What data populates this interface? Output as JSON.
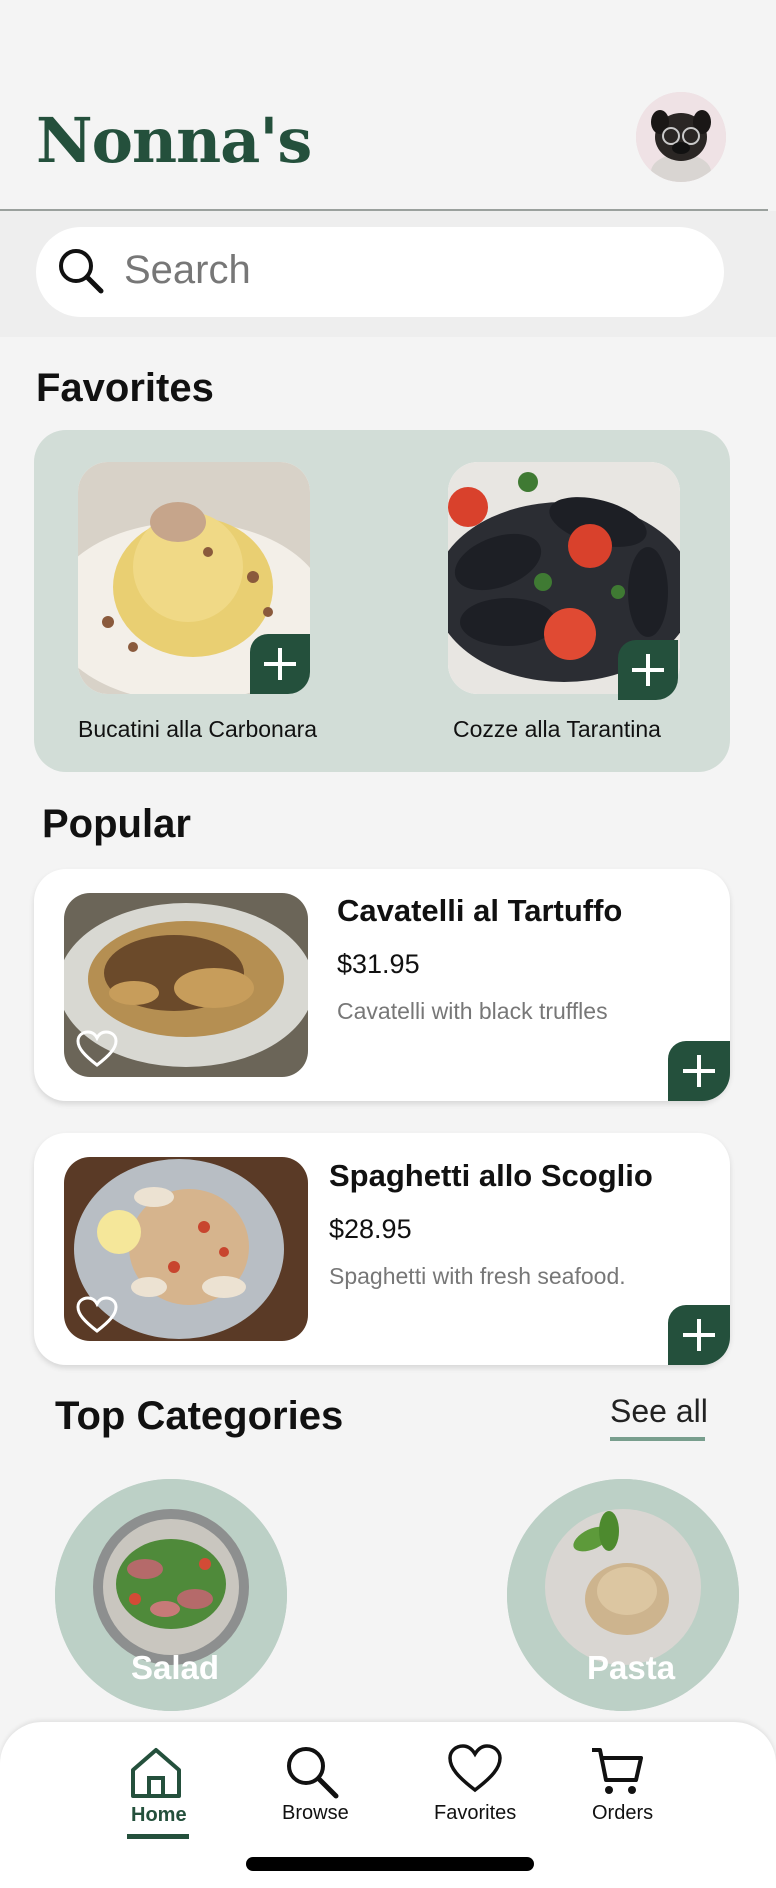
{
  "app": {
    "logo_text": "Nonna's",
    "brand_color": "#24503c",
    "accent_soft": "#d2ddd7"
  },
  "search": {
    "placeholder": "Search",
    "icon": "search-icon"
  },
  "favorites": {
    "title": "Favorites",
    "items": [
      {
        "name": "Bucatini alla Carbonara"
      },
      {
        "name": "Cozze alla Tarantina"
      }
    ]
  },
  "popular": {
    "title": "Popular",
    "items": [
      {
        "name": "Cavatelli al Tartuffo",
        "price": "$31.95",
        "description": "Cavatelli with black truffles"
      },
      {
        "name": "Spaghetti allo Scoglio",
        "price": "$28.95",
        "description": "Spaghetti with fresh seafood."
      }
    ]
  },
  "categories": {
    "title": "Top Categories",
    "see_all": "See all",
    "items": [
      {
        "name": "Salad"
      },
      {
        "name": "Pasta"
      }
    ]
  },
  "nav": {
    "items": [
      {
        "label": "Home",
        "icon": "home-icon",
        "active": true
      },
      {
        "label": "Browse",
        "icon": "search-icon",
        "active": false
      },
      {
        "label": "Favorites",
        "icon": "heart-icon",
        "active": false
      },
      {
        "label": "Orders",
        "icon": "cart-icon",
        "active": false
      }
    ]
  }
}
